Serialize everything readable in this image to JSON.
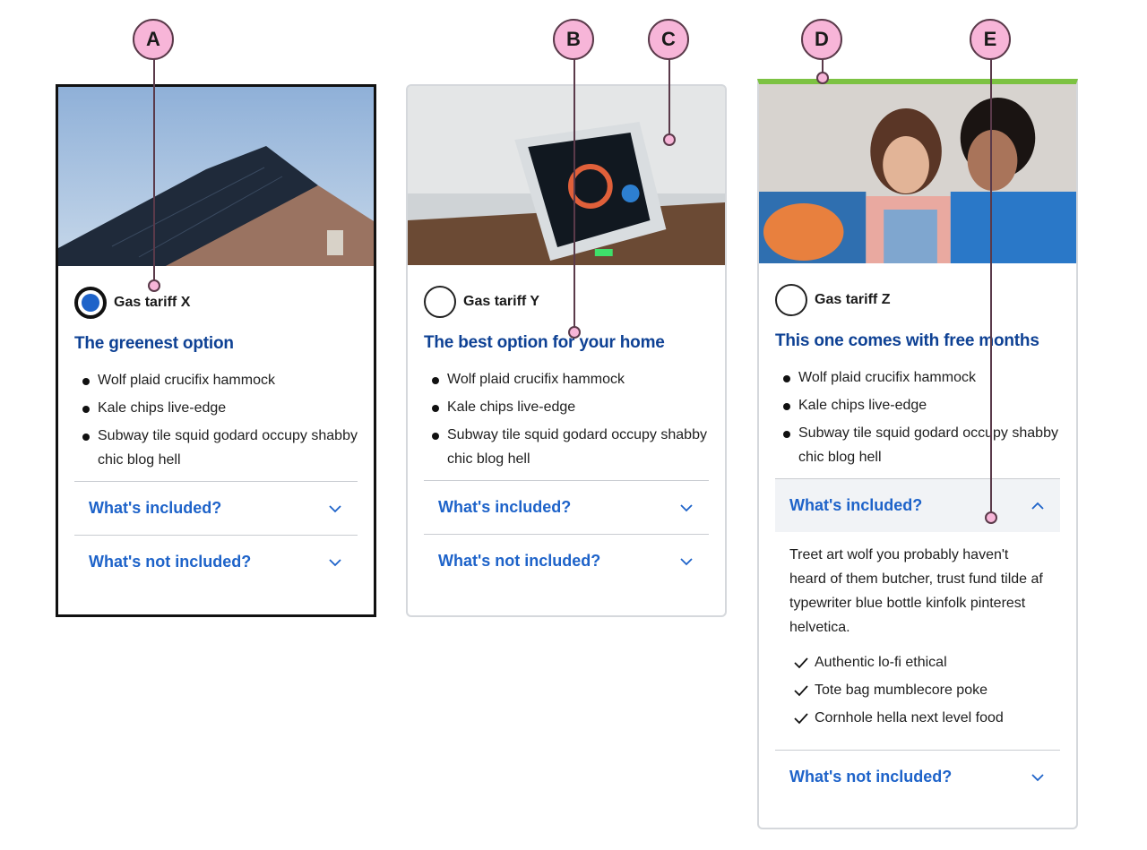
{
  "colors": {
    "accent_blue": "#1e63c9",
    "headline_blue": "#0e4194",
    "featured_green": "#7cc242",
    "marker_pink": "#f7b5d8"
  },
  "markers": [
    "A",
    "B",
    "C",
    "D",
    "E"
  ],
  "cards": [
    {
      "tariff": "Gas tariff X",
      "headline": "The greenest option",
      "selected": true,
      "bullets": [
        "Wolf plaid crucifix hammock",
        "Kale chips live-edge",
        "Subway tile squid godard occupy shabby chic blog hell"
      ],
      "acc_included": "What's included?",
      "acc_not_included": "What's not included?"
    },
    {
      "tariff": "Gas tariff Y",
      "headline": "The best option for your home",
      "selected": false,
      "bullets": [
        "Wolf plaid crucifix hammock",
        "Kale chips live-edge",
        "Subway tile squid godard occupy shabby chic blog hell"
      ],
      "acc_included": "What's included?",
      "acc_not_included": "What's not included?"
    },
    {
      "tariff": "Gas tariff Z",
      "headline": "This one comes with free months",
      "selected": false,
      "bullets": [
        "Wolf plaid crucifix hammock",
        "Kale chips live-edge",
        "Subway tile squid godard occupy shabby chic blog hell"
      ],
      "acc_included": "What's included?",
      "included_text": "Treet art wolf you probably haven't heard of them butcher, trust fund tilde af typewriter blue bottle kinfolk pinterest helvetica.",
      "included_items": [
        "Authentic lo-fi ethical",
        "Tote bag mumblecore poke",
        "Cornhole hella next level food"
      ],
      "acc_not_included": "What's not included?"
    }
  ]
}
